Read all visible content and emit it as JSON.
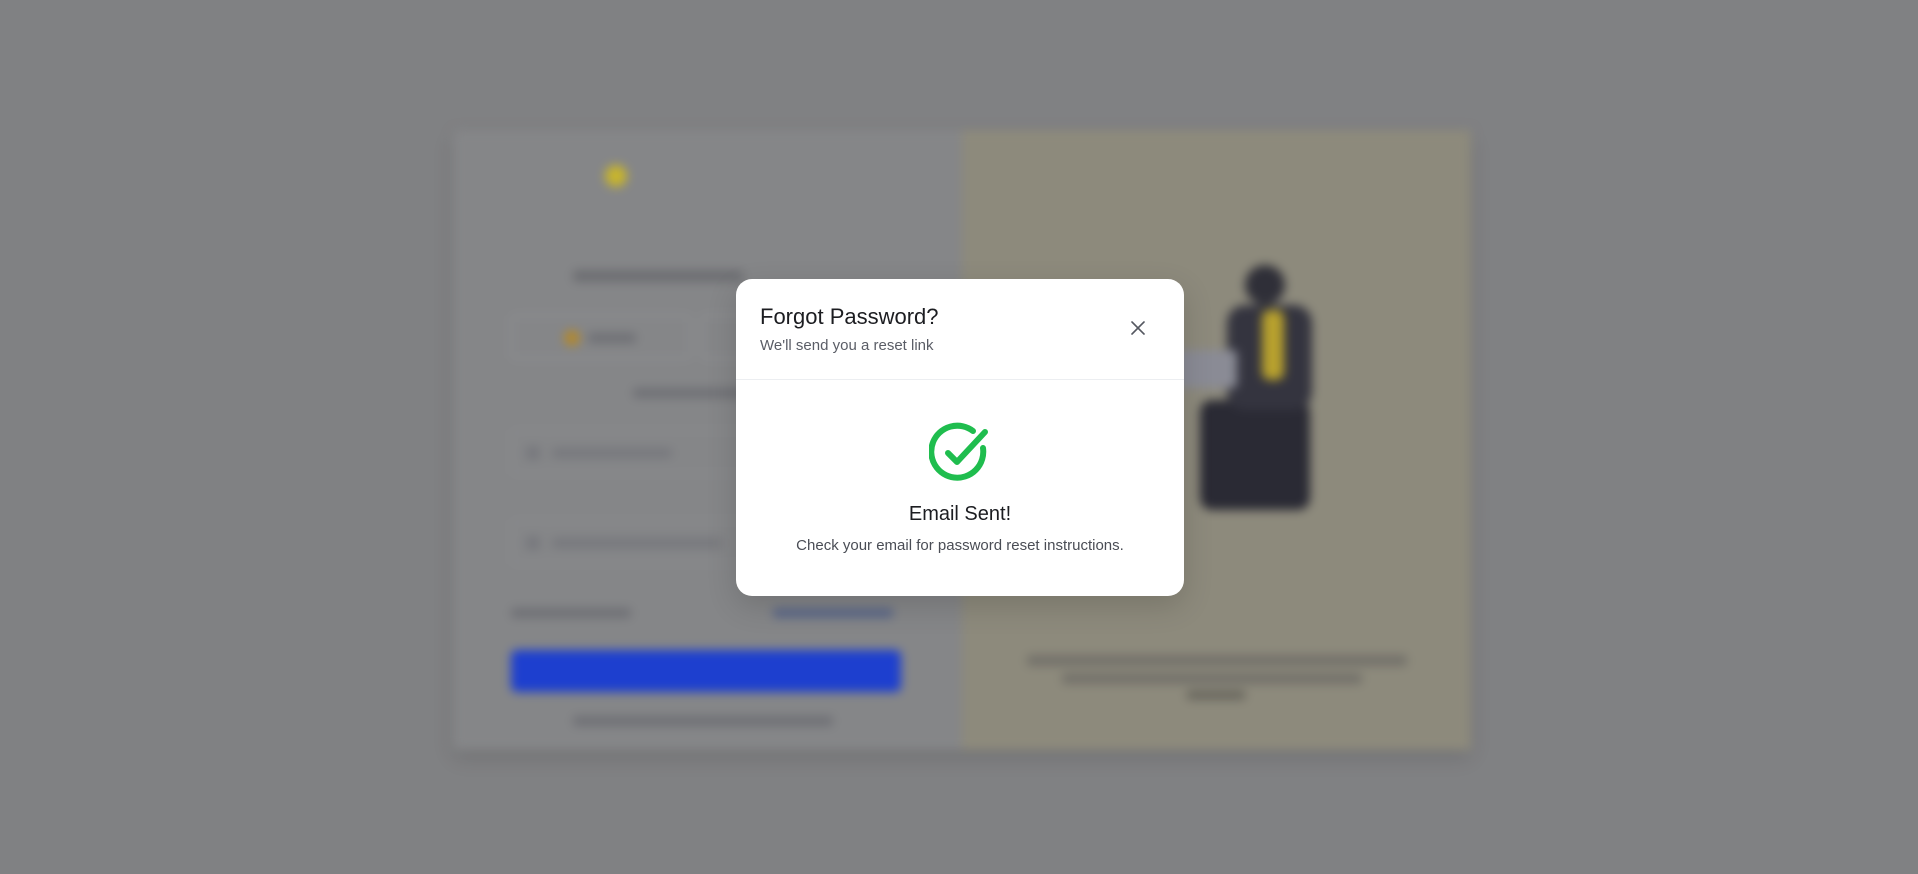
{
  "modal": {
    "title": "Forgot Password?",
    "subtitle": "We'll send you a reset link",
    "close_icon": "close-icon",
    "status_icon": "check-circle-icon",
    "status_color": "#1fbd4e",
    "status_title": "Email Sent!",
    "status_message": "Check your email for password reset instructions."
  },
  "colors": {
    "overlay": "#808183",
    "modal_background": "#ffffff",
    "primary_blue": "#1d3fcf"
  }
}
